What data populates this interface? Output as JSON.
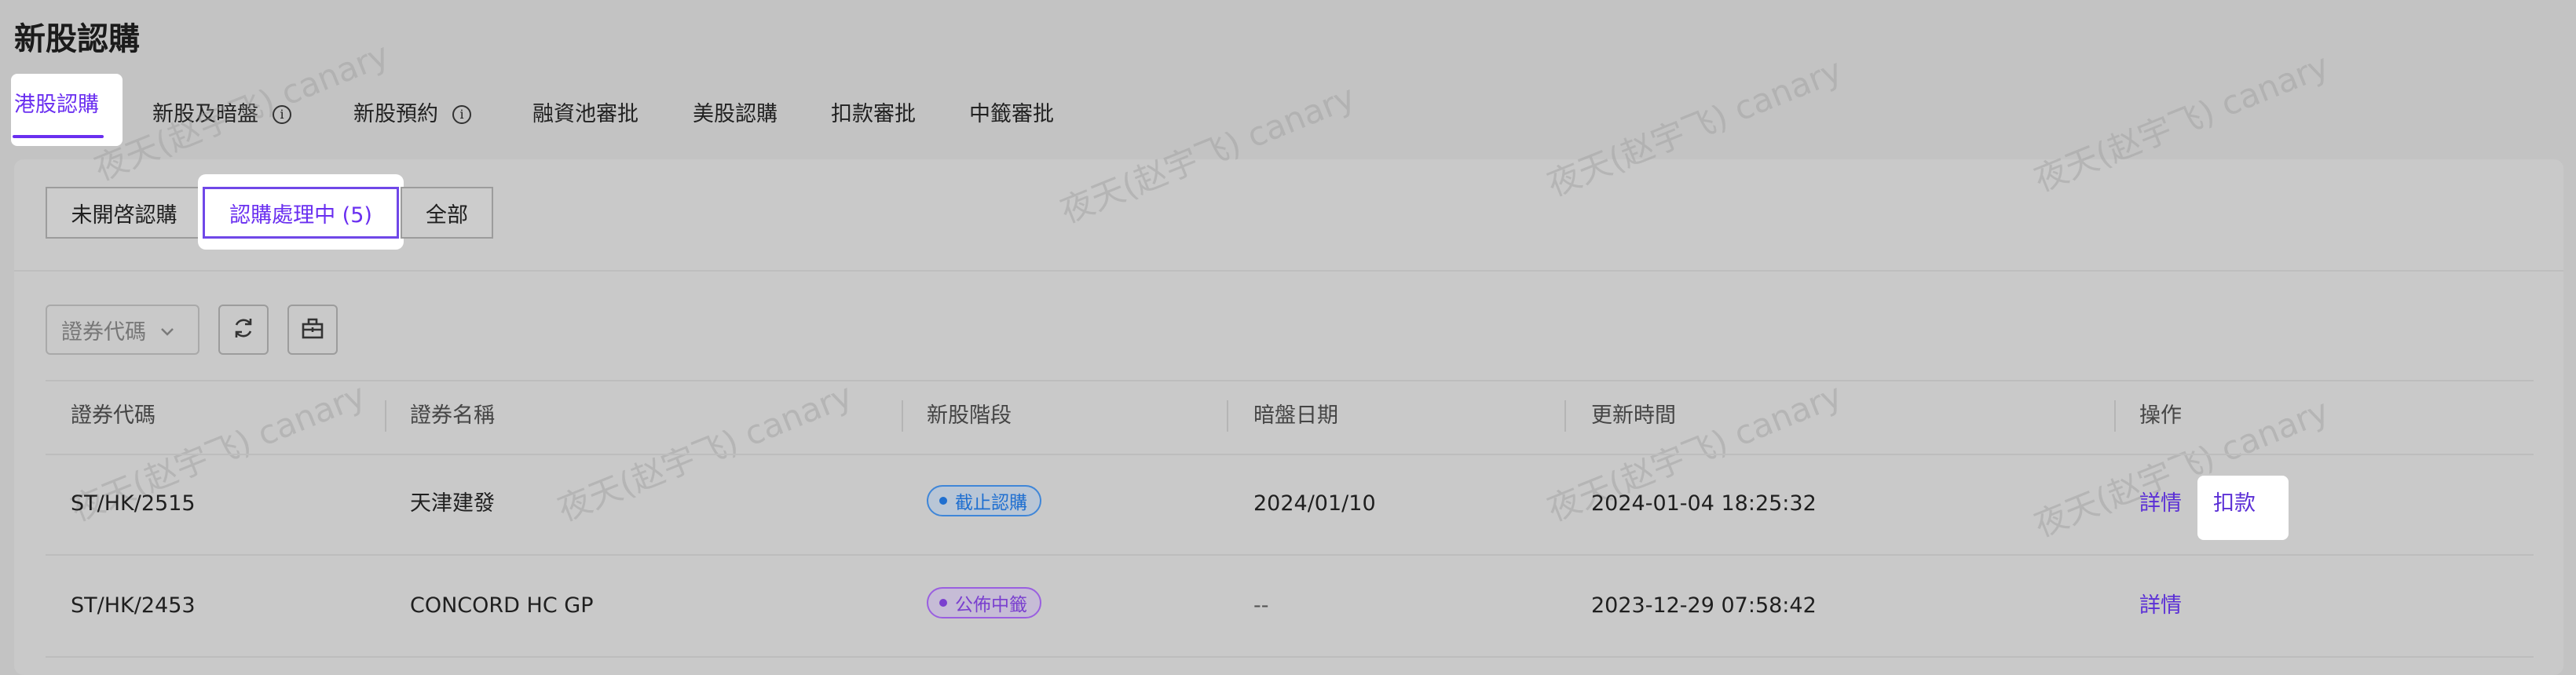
{
  "page": {
    "title": "新股認購"
  },
  "tabs": [
    {
      "label": "港股認購",
      "active": true
    },
    {
      "label": "新股及暗盤",
      "has_info": true
    },
    {
      "label": "新股預約",
      "has_info": true
    },
    {
      "label": "融資池審批"
    },
    {
      "label": "美股認購"
    },
    {
      "label": "扣款審批"
    },
    {
      "label": "中籤審批"
    }
  ],
  "info_glyph": "i",
  "segments": [
    {
      "label": "未開啓認購"
    },
    {
      "label": "認購處理中 (5)",
      "active": true
    },
    {
      "label": "全部"
    }
  ],
  "filter": {
    "placeholder": "證券代碼",
    "chevron": "⌄"
  },
  "toolbar": {
    "refresh_icon": "refresh-icon",
    "export_icon": "export-icon"
  },
  "table": {
    "columns": [
      "證券代碼",
      "證券名稱",
      "新股階段",
      "暗盤日期",
      "更新時間",
      "操作"
    ],
    "rows": [
      {
        "code": "ST/HK/2515",
        "name": "天津建發",
        "stage": "截止認購",
        "grey_date": "2024/01/10",
        "updated": "2024-01-04 18:25:32",
        "actions": [
          "詳情",
          "扣款"
        ]
      },
      {
        "code": "ST/HK/2453",
        "name": "CONCORD HC GP",
        "stage": "公佈中籤",
        "grey_date": "--",
        "updated": "2023-12-29 07:58:42",
        "actions": [
          "詳情"
        ]
      }
    ]
  },
  "watermark": "夜天(赵宇飞) canary",
  "colors": {
    "accent": "#6a2ff0",
    "link": "#5b2fd6",
    "badge_blue": "#1f6fd0",
    "badge_purple": "#7a3fcf",
    "overlay": "#c3c3c3",
    "highlight": "#ffffff"
  }
}
